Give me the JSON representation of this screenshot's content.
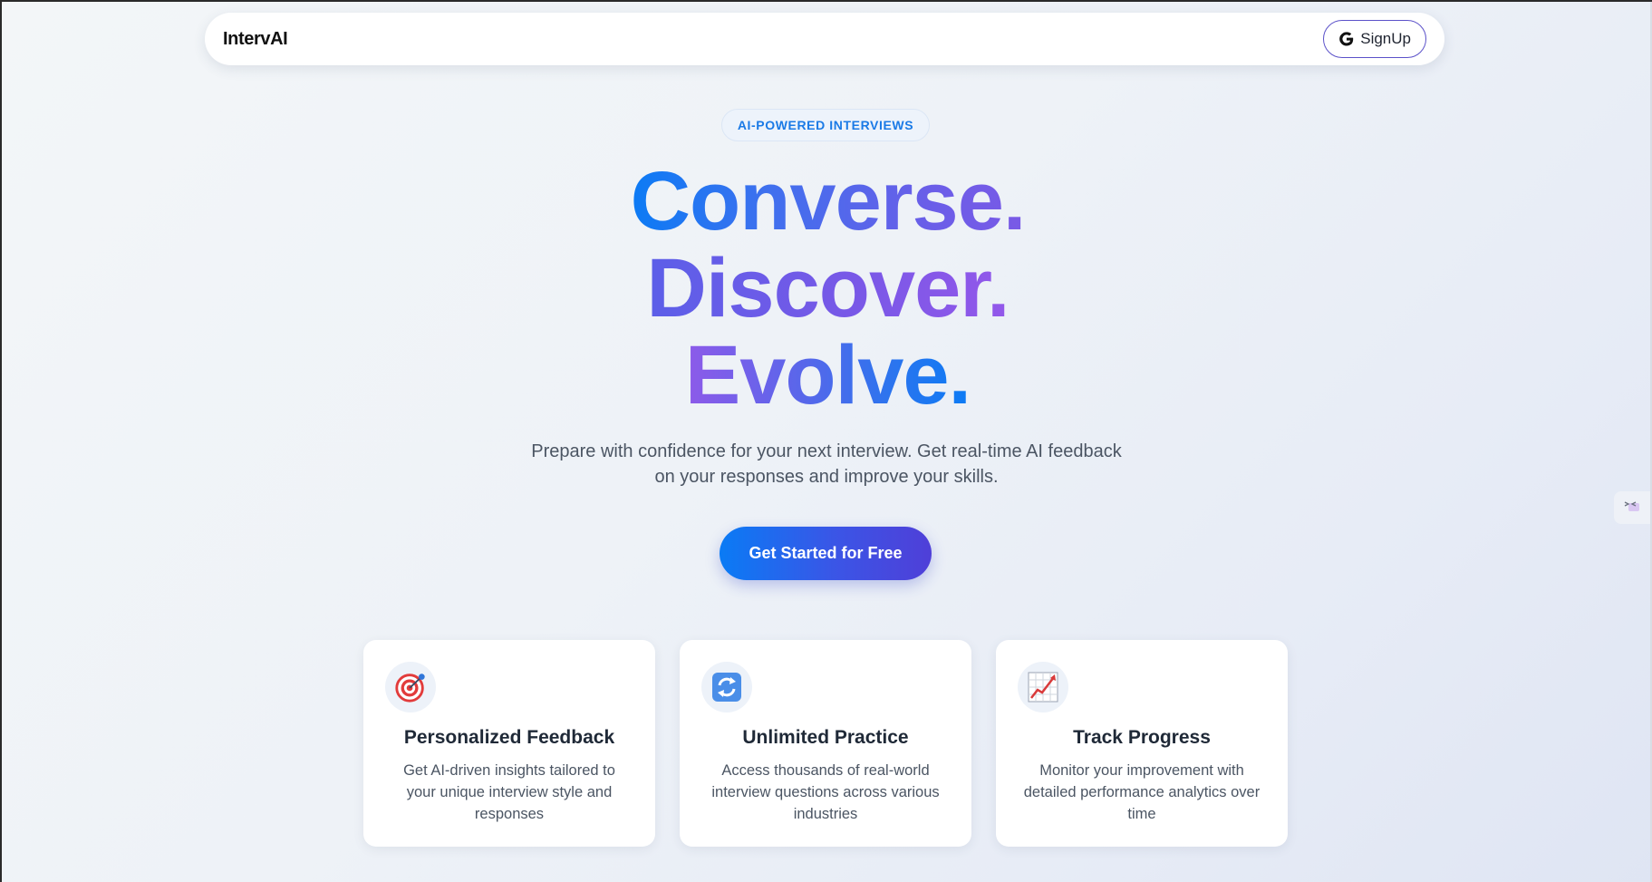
{
  "nav": {
    "logo": "IntervAI",
    "signup_label": "SignUp",
    "signup_icon": "google-g-icon"
  },
  "hero": {
    "badge": "AI-POWERED INTERVIEWS",
    "headline": [
      "Converse.",
      "Discover.",
      "Evolve."
    ],
    "subtitle": "Prepare with confidence for your next interview. Get real-time AI feedback on your responses and improve your skills.",
    "cta_label": "Get Started for Free"
  },
  "features": [
    {
      "icon": "target-icon",
      "title": "Personalized Feedback",
      "description": "Get AI-driven insights tailored to your unique interview style and responses"
    },
    {
      "icon": "refresh-icon",
      "title": "Unlimited Practice",
      "description": "Access thousands of real-world interview questions across various industries"
    },
    {
      "icon": "chart-increasing-icon",
      "title": "Track Progress",
      "description": "Monitor your improvement with detailed performance analytics over time"
    }
  ],
  "side_widget": {
    "icon": "extension-widget-icon"
  },
  "colors": {
    "accent_blue": "#0a7bf5",
    "accent_purple": "#7a59e6",
    "signup_border": "#5b51c9",
    "badge_text": "#1a7ae6"
  }
}
